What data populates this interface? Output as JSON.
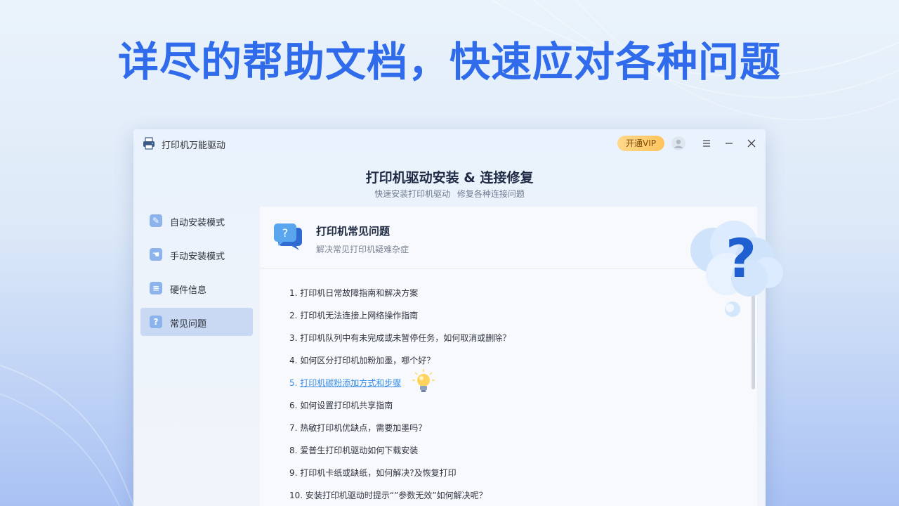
{
  "headline": "详尽的帮助文档，快速应对各种问题",
  "window": {
    "app_name": "打印机万能驱动",
    "vip_label": "开通VIP",
    "title": "打印机驱动安装 & 连接修复",
    "subtitle": "快速安装打印机驱动  修复各种连接问题",
    "icons": [
      "printer-icon",
      "avatar-icon",
      "menu-icon",
      "minimize-icon",
      "close-icon"
    ]
  },
  "sidebar": {
    "items": [
      {
        "label": "自动安装模式",
        "icon": "wrench-icon",
        "glyph": "✎",
        "active": false
      },
      {
        "label": "手动安装模式",
        "icon": "hand-icon",
        "glyph": "☚",
        "active": false
      },
      {
        "label": "硬件信息",
        "icon": "list-icon",
        "glyph": "≡",
        "active": false
      },
      {
        "label": "常见问题",
        "icon": "question-icon",
        "glyph": "?",
        "active": true
      }
    ]
  },
  "content": {
    "title": "打印机常见问题",
    "subtitle": "解决常见打印机疑难杂症",
    "faq": [
      {
        "num": "1.",
        "text": "打印机日常故障指南和解决方案"
      },
      {
        "num": "2.",
        "text": "打印机无法连接上网络操作指南"
      },
      {
        "num": "3.",
        "text": "打印机队列中有未完成或未暂停任务，如何取消或删除？"
      },
      {
        "num": "4.",
        "text": "如何区分打印机加粉加墨，哪个好？"
      },
      {
        "num": "5.",
        "text": "打印机碳粉添加方式和步骤"
      },
      {
        "num": "6.",
        "text": "如何设置打印机共享指南"
      },
      {
        "num": "7.",
        "text": "热敏打印机优缺点，需要加墨吗？"
      },
      {
        "num": "8.",
        "text": "爱普生打印机驱动如何下载安装"
      },
      {
        "num": "9.",
        "text": "打印机卡纸或缺纸，如何解决?及恢复打印"
      },
      {
        "num": "10.",
        "text": "安装打印机驱动时提示“”参数无效”如何解决呢？"
      }
    ]
  },
  "colors": {
    "accent": "#2f6bea",
    "link": "#3a8ee6",
    "active_bg": "#c9d9f3",
    "vip": "#ffc35e"
  }
}
